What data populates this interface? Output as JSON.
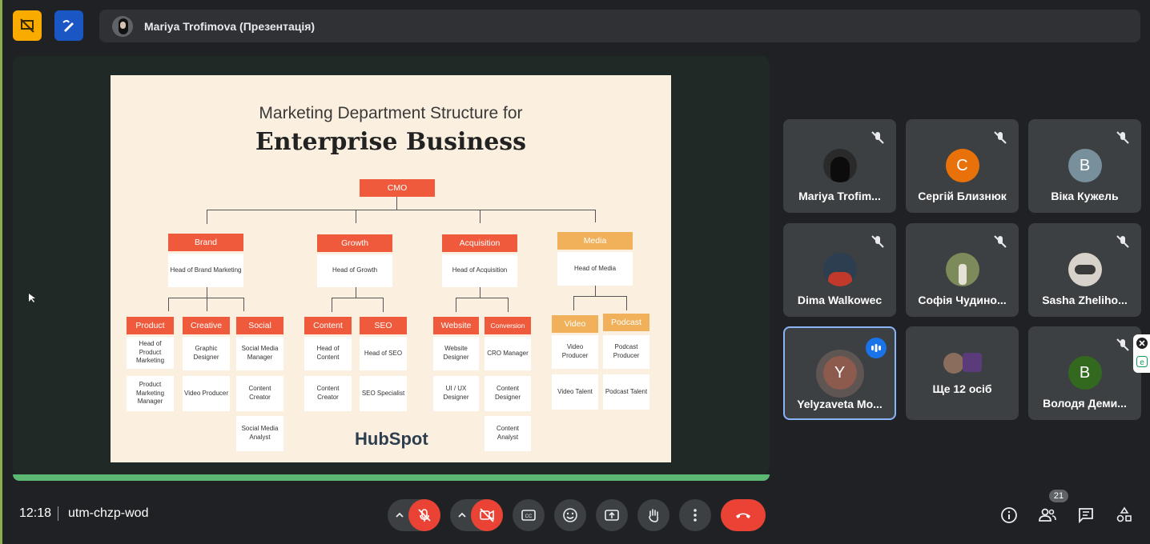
{
  "presenter": {
    "name": "Mariya Trofimova (Презентація)"
  },
  "slide": {
    "title": "Marketing Department Structure for",
    "subtitle": "Enterprise Business",
    "top": "CMO",
    "branding": "HubSpot",
    "departments": [
      {
        "name": "Brand",
        "head": "Head of Brand Marketing"
      },
      {
        "name": "Growth",
        "head": "Head of Growth"
      },
      {
        "name": "Acquisition",
        "head": "Head of Acquisition"
      },
      {
        "name": "Media",
        "head": "Head of Media"
      }
    ],
    "teams": [
      {
        "name": "Product",
        "roles": [
          "Head of Product Marketing",
          "Product Marketing Manager"
        ]
      },
      {
        "name": "Creative",
        "roles": [
          "Graphic Designer",
          "Video Producer"
        ]
      },
      {
        "name": "Social",
        "roles": [
          "Social Media Manager",
          "Content Creator",
          "Social Media Analyst"
        ]
      },
      {
        "name": "Content",
        "roles": [
          "Head of Content",
          "Content Creator"
        ]
      },
      {
        "name": "SEO",
        "roles": [
          "Head of SEO",
          "SEO Specialist"
        ]
      },
      {
        "name": "Website",
        "roles": [
          "Website Designer",
          "UI / UX Designer"
        ]
      },
      {
        "name": "Conversion",
        "roles": [
          "CRO Manager",
          "Content Designer",
          "Content Analyst"
        ]
      },
      {
        "name": "Video",
        "roles": [
          "Video Producer",
          "Video Talent"
        ]
      },
      {
        "name": "Podcast",
        "roles": [
          "Podcast Producer",
          "Podcast Talent"
        ]
      }
    ]
  },
  "participants": [
    {
      "name": "Mariya Trofim...",
      "initial": "",
      "color": "#5f6368"
    },
    {
      "name": "Сергій Близнюк",
      "initial": "С",
      "color": "#e8710a"
    },
    {
      "name": "Віка Кужель",
      "initial": "В",
      "color": "#78909c"
    },
    {
      "name": "Dima Walkowec",
      "initial": "",
      "color": "#8b3a2e"
    },
    {
      "name": "Софія Чудино...",
      "initial": "",
      "color": "#6b7a4b"
    },
    {
      "name": "Sasha Zheliho...",
      "initial": "",
      "color": "#c9c4bb"
    },
    {
      "name": "Yelyzaveta Mo...",
      "initial": "Y",
      "color": "#8d5a4e"
    },
    {
      "name": "Ще 12 осіб",
      "initial": "",
      "color": ""
    },
    {
      "name": "Володя Деми...",
      "initial": "В",
      "color": "#33691e"
    }
  ],
  "bottom": {
    "time": "12:18",
    "meeting_code": "utm-chzp-wod",
    "participant_count": "21"
  },
  "colors": {
    "accent": "#8ab4f8",
    "end_call": "#ea4335",
    "progress": "#5bb974"
  }
}
